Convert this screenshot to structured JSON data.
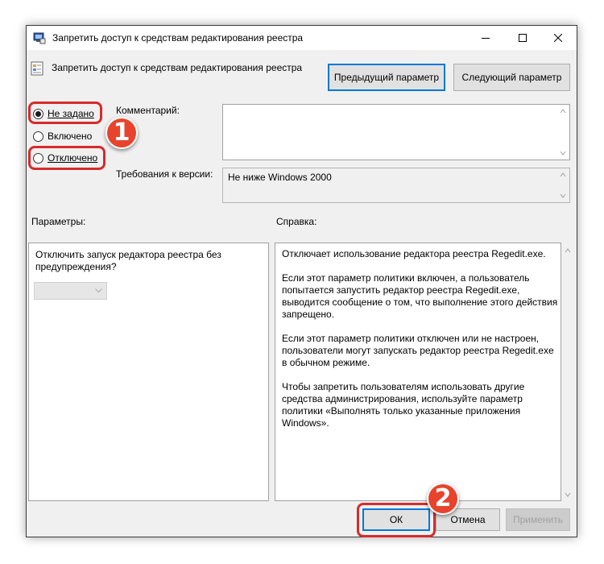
{
  "window": {
    "title": "Запретить доступ к средствам редактирования реестра",
    "icons": [
      "registry-policy-icon",
      "minimize-icon",
      "maximize-icon",
      "close-icon"
    ]
  },
  "header": {
    "policy_name": "Запретить доступ к средствам редактирования реестра",
    "prev_button": "Предыдущий параметр",
    "next_button": "Следующий параметр"
  },
  "state": {
    "options": [
      {
        "label": "Не задано",
        "checked": true
      },
      {
        "label": "Включено",
        "checked": false
      },
      {
        "label": "Отключено",
        "checked": false
      }
    ]
  },
  "comment": {
    "label": "Комментарий:",
    "value": ""
  },
  "version": {
    "label": "Требования к версии:",
    "value": "Не ниже Windows 2000"
  },
  "params": {
    "label": "Параметры:",
    "option_text": "Отключить запуск редактора реестра без предупреждения?",
    "dropdown_value": ""
  },
  "help": {
    "label": "Справка:",
    "paragraphs": [
      "Отключает использование редактора реестра Regedit.exe.",
      "Если этот параметр политики включен, а пользователь попытается запустить редактор реестра Regedit.exe, выводится сообщение о том, что выполнение этого действия запрещено.",
      "Если этот параметр политики отключен или не настроен, пользователи могут запускать редактор реестра Regedit.exe в обычном режиме.",
      "Чтобы запретить пользователям использовать другие средства администрирования, используйте параметр политики «Выполнять только указанные приложения Windows»."
    ]
  },
  "footer": {
    "ok": "ОК",
    "cancel": "Отмена",
    "apply": "Применить"
  },
  "annotations": {
    "badge1": "1",
    "badge2": "2",
    "highlight_color": "#d62b2b",
    "badge_color": "#e8442d"
  },
  "colors": {
    "accent": "#0078d7",
    "window_bg": "#f0f0f0"
  }
}
